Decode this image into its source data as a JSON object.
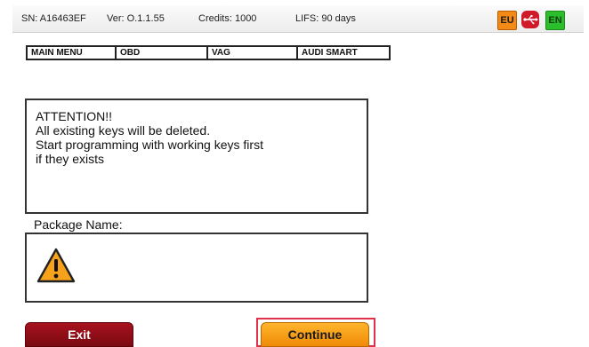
{
  "status": {
    "sn": "SN: A16463EF",
    "version": "Ver: O.1.1.55",
    "credits": "Credits: 1000",
    "lifs": "LIFS: 90 days",
    "flag_eu": "EU",
    "flag_en": "EN",
    "usb_icon": "usb-icon"
  },
  "breadcrumb": [
    "MAIN MENU",
    "OBD",
    "VAG",
    "AUDI SMART"
  ],
  "message": {
    "lines": [
      "ATTENTION!!",
      "All existing keys will be deleted.",
      "Start programming with working keys first",
      "if they exists"
    ]
  },
  "package": {
    "label": "Package Name:",
    "icon": "warning-icon"
  },
  "buttons": {
    "exit": "Exit",
    "continue": "Continue"
  },
  "colors": {
    "exit": "#8e0f18",
    "continue": "#f7a21a",
    "highlight": "#e0304a"
  }
}
